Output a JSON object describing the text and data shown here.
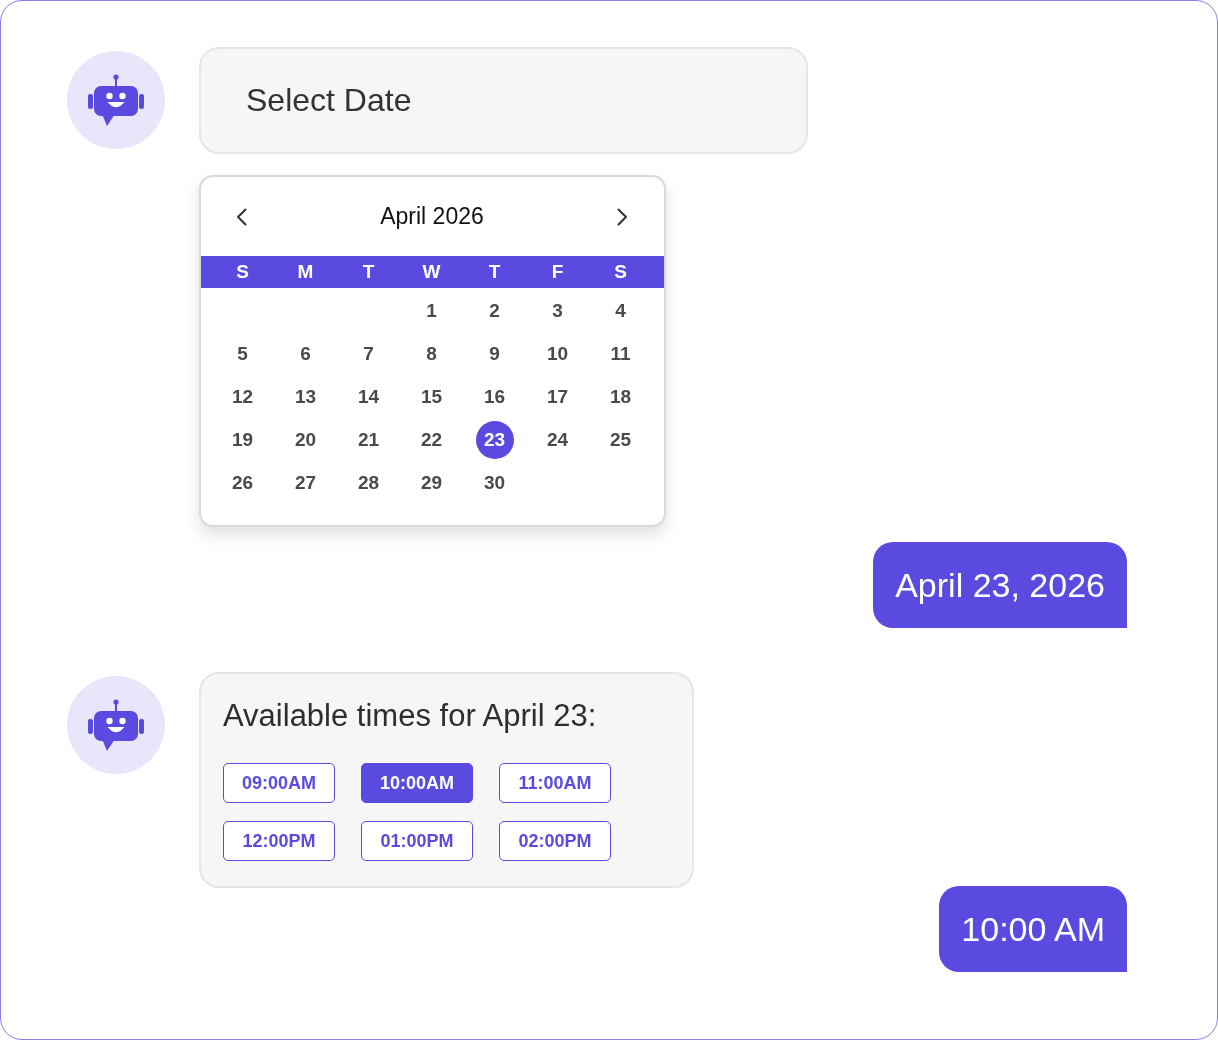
{
  "messages": [
    {
      "kind": "bot",
      "text": "Select Date",
      "calendar": {
        "month": "April 2026",
        "weekdays": [
          "S",
          "M",
          "T",
          "W",
          "T",
          "F",
          "S"
        ],
        "weeks": [
          [
            {
              "day": "1",
              "selected": false
            },
            {
              "day": "2",
              "selected": false
            },
            {
              "day": "3",
              "selected": false
            },
            {
              "day": "4",
              "selected": false
            }
          ],
          [
            {
              "day": "5",
              "selected": false
            },
            {
              "day": "6",
              "selected": false
            },
            {
              "day": "7",
              "selected": false
            },
            {
              "day": "8",
              "selected": false
            },
            {
              "day": "9",
              "selected": false
            },
            {
              "day": "10",
              "selected": false
            },
            {
              "day": "11",
              "selected": false
            }
          ],
          [
            {
              "day": "12",
              "selected": false
            },
            {
              "day": "13",
              "selected": false
            },
            {
              "day": "14",
              "selected": false
            },
            {
              "day": "15",
              "selected": false
            },
            {
              "day": "16",
              "selected": false
            },
            {
              "day": "17",
              "selected": false
            },
            {
              "day": "18",
              "selected": false
            }
          ],
          [
            {
              "day": "19",
              "selected": false
            },
            {
              "day": "20",
              "selected": false
            },
            {
              "day": "21",
              "selected": false
            },
            {
              "day": "22",
              "selected": false
            },
            {
              "day": "23",
              "selected": true
            },
            {
              "day": "24",
              "selected": false
            },
            {
              "day": "25",
              "selected": false
            }
          ],
          [
            {
              "day": "26",
              "selected": false
            },
            {
              "day": "27",
              "selected": false
            },
            {
              "day": "28",
              "selected": false
            },
            {
              "day": "29",
              "selected": false
            },
            {
              "day": "30",
              "selected": false
            }
          ]
        ]
      }
    },
    {
      "kind": "user",
      "text": "April 23, 2026"
    },
    {
      "kind": "bot",
      "text": "Available times for April 23:",
      "time_slots": [
        {
          "label": "09:00AM",
          "selected": false
        },
        {
          "label": "10:00AM",
          "selected": true
        },
        {
          "label": "11:00AM",
          "selected": false
        },
        {
          "label": "12:00PM",
          "selected": false
        },
        {
          "label": "01:00PM",
          "selected": false
        },
        {
          "label": "02:00PM",
          "selected": false
        }
      ]
    },
    {
      "kind": "user",
      "text": "10:00 AM"
    }
  ]
}
